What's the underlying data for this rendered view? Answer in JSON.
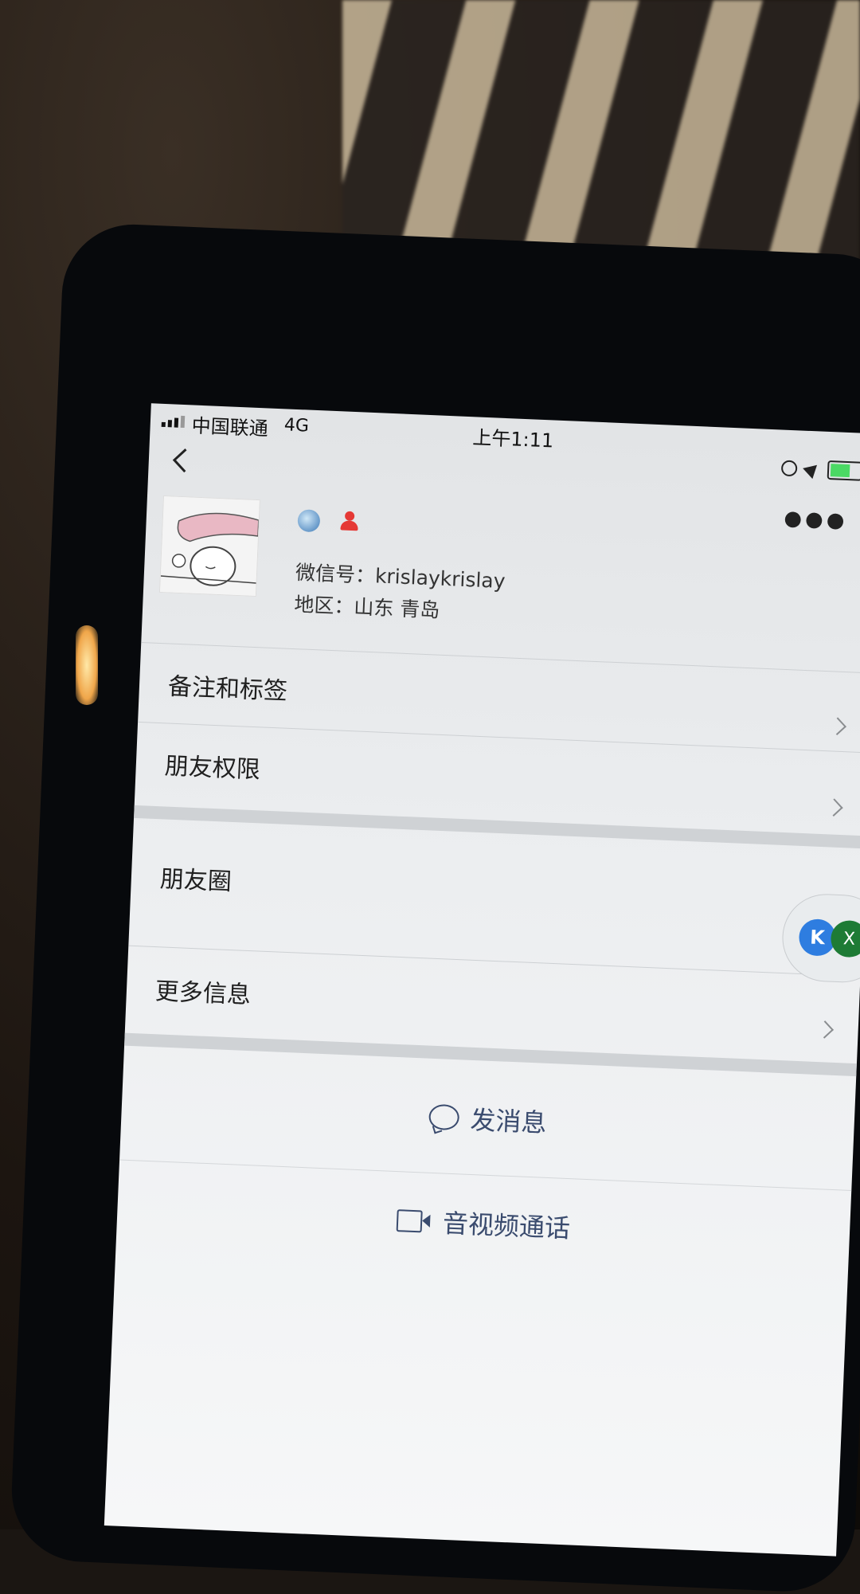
{
  "status_bar": {
    "carrier": "中国联通",
    "network": "4G",
    "time": "上午1:11"
  },
  "profile": {
    "wechat_id": "微信号：krislaykrislay",
    "region": "地区：山东 青岛"
  },
  "menu": {
    "items": [
      {
        "label": "备注和标签"
      },
      {
        "label": "朋友权限"
      },
      {
        "label": "朋友圈"
      },
      {
        "label": "更多信息"
      }
    ]
  },
  "actions": {
    "send_message": "发消息",
    "video_call": "音视频通话"
  },
  "floating": {
    "badge_k": "K",
    "badge_x": "X"
  },
  "icons": [
    "back-icon",
    "more-icon",
    "pin-icon",
    "person-icon",
    "chevron-icon",
    "chat-icon",
    "video-icon"
  ]
}
